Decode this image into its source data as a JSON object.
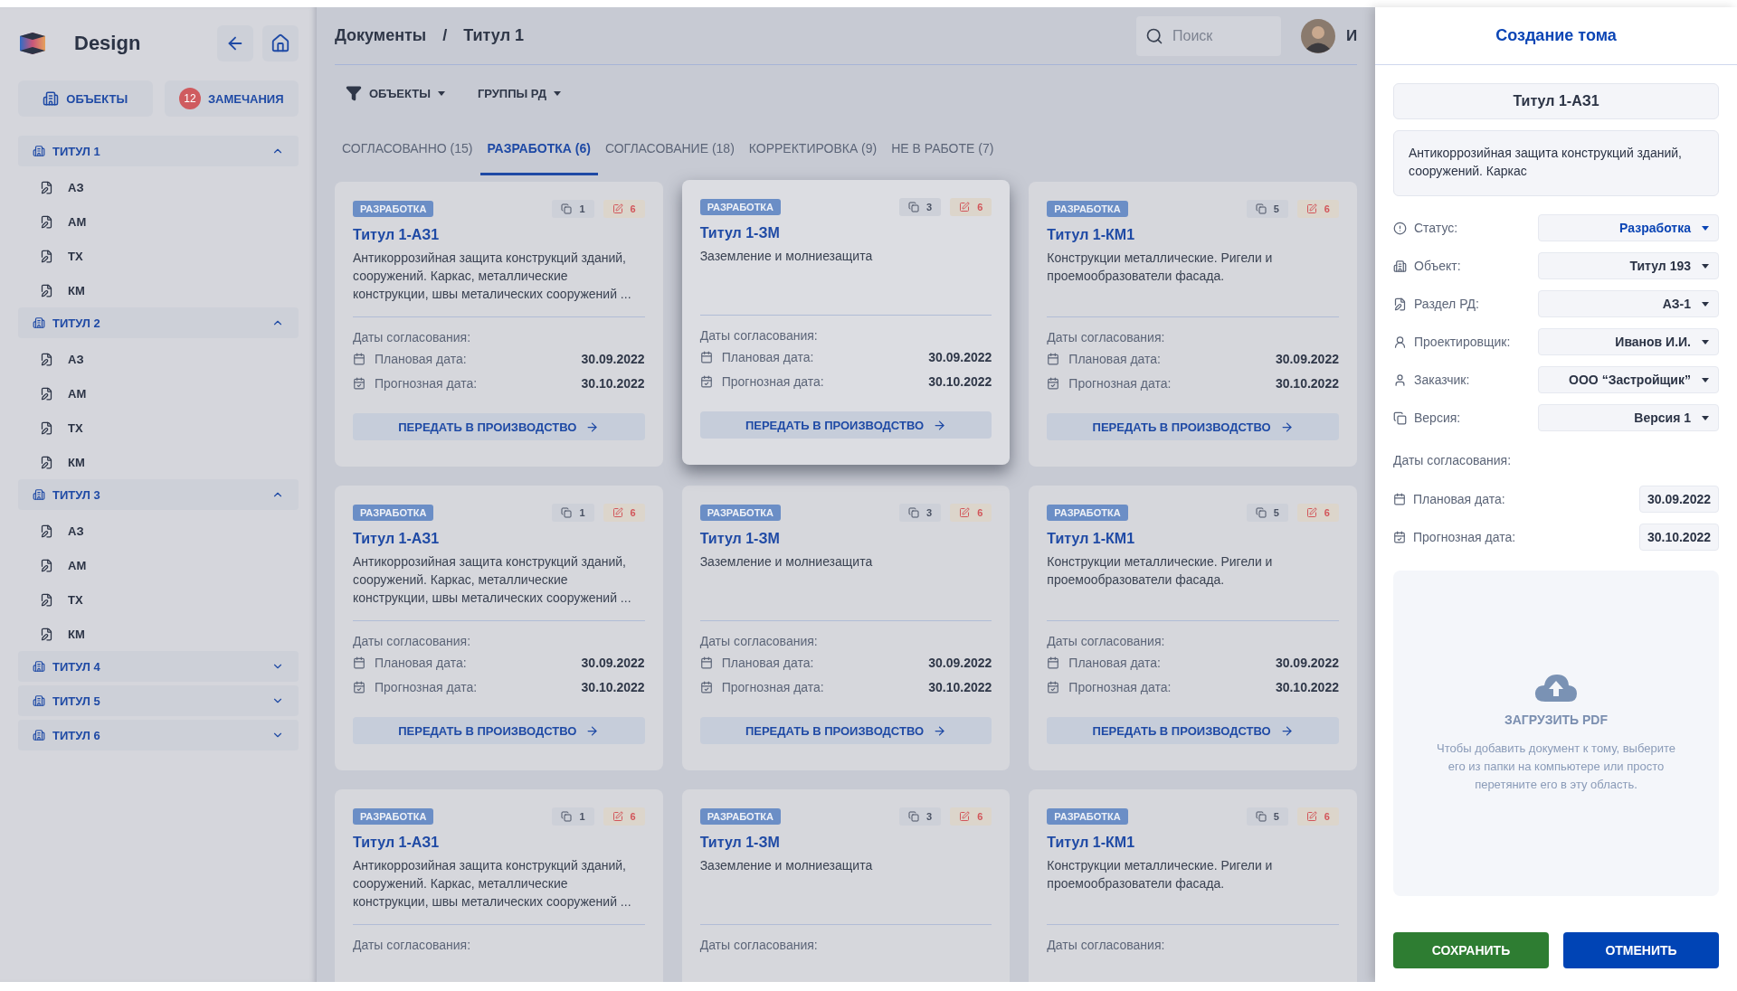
{
  "sidebar": {
    "brand": "Design",
    "buttons": [
      {
        "kind": "objects",
        "label": "ОБЪЕКТЫ"
      },
      {
        "kind": "remarks",
        "label": "ЗАМЕЧАНИЯ",
        "badge": "12"
      }
    ],
    "groups": [
      {
        "label": "ТИТУЛ 1",
        "expanded": true,
        "children": [
          {
            "label": "АЗ"
          },
          {
            "label": "АМ"
          },
          {
            "label": "ТХ"
          },
          {
            "label": "КМ"
          }
        ]
      },
      {
        "label": "ТИТУЛ 2",
        "expanded": true,
        "children": [
          {
            "label": "АЗ"
          },
          {
            "label": "АМ"
          },
          {
            "label": "ТХ"
          },
          {
            "label": "КМ"
          }
        ]
      },
      {
        "label": "ТИТУЛ 3",
        "expanded": true,
        "children": [
          {
            "label": "АЗ"
          },
          {
            "label": "АМ"
          },
          {
            "label": "ТХ"
          },
          {
            "label": "КМ"
          }
        ]
      },
      {
        "label": "ТИТУЛ 4",
        "expanded": false
      },
      {
        "label": "ТИТУЛ 5",
        "expanded": false
      },
      {
        "label": "ТИТУЛ 6",
        "expanded": false
      }
    ]
  },
  "header": {
    "breadcrumb": [
      "Документы",
      "/",
      "Титул 1"
    ],
    "search": {
      "placeholder": "Поиск"
    },
    "user": "И"
  },
  "filters": [
    {
      "kind": "filter",
      "label": "ОБЪЕКТЫ"
    },
    {
      "kind": "plain",
      "label": "ГРУППЫ РД"
    }
  ],
  "tabs": [
    {
      "label": "СОГЛАСОВАННО (15)",
      "selected": false
    },
    {
      "label": "РАЗРАБОТКА (6)",
      "selected": true
    },
    {
      "label": "СОГЛАСОВАНИЕ (18)",
      "selected": false
    },
    {
      "label": "КОРРЕКТИРОВКА (9)",
      "selected": false
    },
    {
      "label": "НЕ В РАБОТЕ (7)",
      "selected": false
    }
  ],
  "cards": [
    {
      "status": "РАЗРАБОТКА",
      "versions": "1",
      "remarks": "6",
      "title": "Титул 1-АЗ1",
      "description": "Антикоррозийная защита конструкций зданий, сооружений. Каркас, металлические конструкции, швы металических сооружений ...",
      "dates_label": "Даты согласования:",
      "dates": [
        {
          "kind": "plan",
          "label": "Плановая дата:",
          "value": "30.09.2022"
        },
        {
          "kind": "forecast",
          "label": "Прогнозная дата:",
          "value": "30.10.2022"
        }
      ],
      "action": "ПЕРЕДАТЬ В ПРОИЗВОДСТВО",
      "hovered": false
    },
    {
      "status": "РАЗРАБОТКА",
      "versions": "3",
      "remarks": "6",
      "title": "Титул 1-ЗМ",
      "description": "Заземление и молниезащита",
      "dates_label": "Даты согласования:",
      "dates": [
        {
          "kind": "plan",
          "label": "Плановая дата:",
          "value": "30.09.2022"
        },
        {
          "kind": "forecast",
          "label": "Прогнозная дата:",
          "value": "30.10.2022"
        }
      ],
      "action": "ПЕРЕДАТЬ В ПРОИЗВОДСТВО",
      "hovered": true
    },
    {
      "status": "РАЗРАБОТКА",
      "versions": "5",
      "remarks": "6",
      "title": "Титул 1-КМ1",
      "description": "Конструкции металлические. Ригели и проемообразователи фасада.",
      "dates_label": "Даты согласования:",
      "dates": [
        {
          "kind": "plan",
          "label": "Плановая дата:",
          "value": "30.09.2022"
        },
        {
          "kind": "forecast",
          "label": "Прогнозная дата:",
          "value": "30.10.2022"
        }
      ],
      "action": "ПЕРЕДАТЬ В ПРОИЗВОДСТВО",
      "hovered": false
    },
    {
      "status": "РАЗРАБОТКА",
      "versions": "1",
      "remarks": "6",
      "title": "Титул 1-АЗ1",
      "description": "Антикоррозийная защита конструкций зданий, сооружений. Каркас, металлические конструкции, швы металических сооружений ...",
      "dates_label": "Даты согласования:",
      "dates": [
        {
          "kind": "plan",
          "label": "Плановая дата:",
          "value": "30.09.2022"
        },
        {
          "kind": "forecast",
          "label": "Прогнозная дата:",
          "value": "30.10.2022"
        }
      ],
      "action": "ПЕРЕДАТЬ В ПРОИЗВОДСТВО",
      "hovered": false
    },
    {
      "status": "РАЗРАБОТКА",
      "versions": "3",
      "remarks": "6",
      "title": "Титул 1-ЗМ",
      "description": "Заземление и молниезащита",
      "dates_label": "Даты согласования:",
      "dates": [
        {
          "kind": "plan",
          "label": "Плановая дата:",
          "value": "30.09.2022"
        },
        {
          "kind": "forecast",
          "label": "Прогнозная дата:",
          "value": "30.10.2022"
        }
      ],
      "action": "ПЕРЕДАТЬ В ПРОИЗВОДСТВО",
      "hovered": false
    },
    {
      "status": "РАЗРАБОТКА",
      "versions": "5",
      "remarks": "6",
      "title": "Титул 1-КМ1",
      "description": "Конструкции металлические. Ригели и проемообразователи фасада.",
      "dates_label": "Даты согласования:",
      "dates": [
        {
          "kind": "plan",
          "label": "Плановая дата:",
          "value": "30.09.2022"
        },
        {
          "kind": "forecast",
          "label": "Прогнозная дата:",
          "value": "30.10.2022"
        }
      ],
      "action": "ПЕРЕДАТЬ В ПРОИЗВОДСТВО",
      "hovered": false
    },
    {
      "status": "РАЗРАБОТКА",
      "versions": "1",
      "remarks": "6",
      "title": "Титул 1-АЗ1",
      "description": "Антикоррозийная защита конструкций зданий, сооружений. Каркас, металлические конструкции, швы металических сооружений ...",
      "dates_label": "Даты согласования:",
      "hovered": false
    },
    {
      "status": "РАЗРАБОТКА",
      "versions": "3",
      "remarks": "6",
      "title": "Титул 1-ЗМ",
      "description": "Заземление и молниезащита",
      "dates_label": "Даты согласования:",
      "hovered": false
    },
    {
      "status": "РАЗРАБОТКА",
      "versions": "5",
      "remarks": "6",
      "title": "Титул 1-КМ1",
      "description": "Конструкции металлические. Ригели и проемообразователи фасада.",
      "dates_label": "Даты согласования:",
      "hovered": false
    }
  ],
  "panel": {
    "title": "Создание тома",
    "name": {
      "value": "Титул 1-АЗ1"
    },
    "description": {
      "value": "Антикоррозийная защита конструкций зданий, сооружений. Каркас"
    },
    "fields": [
      {
        "kind": "status",
        "label": "Статус:",
        "value": "Разработка"
      },
      {
        "kind": "object",
        "label": "Объект:",
        "value": "Титул 193"
      },
      {
        "kind": "section",
        "label": "Раздел РД:",
        "value": "АЗ-1"
      },
      {
        "kind": "designer",
        "label": "Проектировщик:",
        "value": "Иванов И.И."
      },
      {
        "kind": "customer",
        "label": "Заказчик:",
        "value": "ООО “Застройщик”"
      },
      {
        "kind": "version",
        "label": "Версия:",
        "value": "Версия 1"
      }
    ],
    "dates_label": "Даты согласования:",
    "dates": [
      {
        "kind": "plan",
        "label": "Плановая дата:",
        "value": "30.09.2022"
      },
      {
        "kind": "forecast",
        "label": "Прогнозная дата:",
        "value": "30.10.2022"
      }
    ],
    "upload": {
      "title": "ЗАГРУЗИТЬ PDF",
      "hint": "Чтобы добавить документ к тому, выберите его из папки на компьютере или просто перетяните его в эту область."
    },
    "buttons": [
      {
        "kind": "save",
        "label": "СОХРАНИТЬ"
      },
      {
        "kind": "cancel",
        "label": "ОТМЕНИТЬ"
      }
    ]
  }
}
